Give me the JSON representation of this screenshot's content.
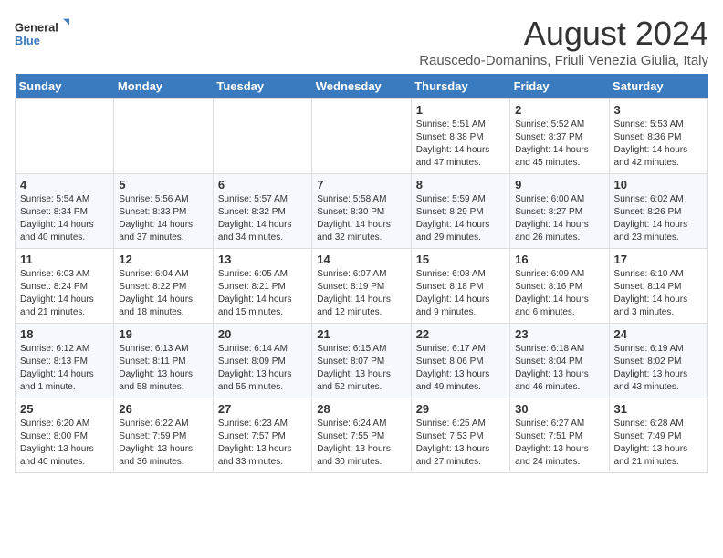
{
  "logo": {
    "line1": "General",
    "line2": "Blue"
  },
  "title": "August 2024",
  "subtitle": "Rauscedo-Domanins, Friuli Venezia Giulia, Italy",
  "days_of_week": [
    "Sunday",
    "Monday",
    "Tuesday",
    "Wednesday",
    "Thursday",
    "Friday",
    "Saturday"
  ],
  "weeks": [
    [
      {
        "num": "",
        "info": ""
      },
      {
        "num": "",
        "info": ""
      },
      {
        "num": "",
        "info": ""
      },
      {
        "num": "",
        "info": ""
      },
      {
        "num": "1",
        "info": "Sunrise: 5:51 AM\nSunset: 8:38 PM\nDaylight: 14 hours and 47 minutes."
      },
      {
        "num": "2",
        "info": "Sunrise: 5:52 AM\nSunset: 8:37 PM\nDaylight: 14 hours and 45 minutes."
      },
      {
        "num": "3",
        "info": "Sunrise: 5:53 AM\nSunset: 8:36 PM\nDaylight: 14 hours and 42 minutes."
      }
    ],
    [
      {
        "num": "4",
        "info": "Sunrise: 5:54 AM\nSunset: 8:34 PM\nDaylight: 14 hours and 40 minutes."
      },
      {
        "num": "5",
        "info": "Sunrise: 5:56 AM\nSunset: 8:33 PM\nDaylight: 14 hours and 37 minutes."
      },
      {
        "num": "6",
        "info": "Sunrise: 5:57 AM\nSunset: 8:32 PM\nDaylight: 14 hours and 34 minutes."
      },
      {
        "num": "7",
        "info": "Sunrise: 5:58 AM\nSunset: 8:30 PM\nDaylight: 14 hours and 32 minutes."
      },
      {
        "num": "8",
        "info": "Sunrise: 5:59 AM\nSunset: 8:29 PM\nDaylight: 14 hours and 29 minutes."
      },
      {
        "num": "9",
        "info": "Sunrise: 6:00 AM\nSunset: 8:27 PM\nDaylight: 14 hours and 26 minutes."
      },
      {
        "num": "10",
        "info": "Sunrise: 6:02 AM\nSunset: 8:26 PM\nDaylight: 14 hours and 23 minutes."
      }
    ],
    [
      {
        "num": "11",
        "info": "Sunrise: 6:03 AM\nSunset: 8:24 PM\nDaylight: 14 hours and 21 minutes."
      },
      {
        "num": "12",
        "info": "Sunrise: 6:04 AM\nSunset: 8:22 PM\nDaylight: 14 hours and 18 minutes."
      },
      {
        "num": "13",
        "info": "Sunrise: 6:05 AM\nSunset: 8:21 PM\nDaylight: 14 hours and 15 minutes."
      },
      {
        "num": "14",
        "info": "Sunrise: 6:07 AM\nSunset: 8:19 PM\nDaylight: 14 hours and 12 minutes."
      },
      {
        "num": "15",
        "info": "Sunrise: 6:08 AM\nSunset: 8:18 PM\nDaylight: 14 hours and 9 minutes."
      },
      {
        "num": "16",
        "info": "Sunrise: 6:09 AM\nSunset: 8:16 PM\nDaylight: 14 hours and 6 minutes."
      },
      {
        "num": "17",
        "info": "Sunrise: 6:10 AM\nSunset: 8:14 PM\nDaylight: 14 hours and 3 minutes."
      }
    ],
    [
      {
        "num": "18",
        "info": "Sunrise: 6:12 AM\nSunset: 8:13 PM\nDaylight: 14 hours and 1 minute."
      },
      {
        "num": "19",
        "info": "Sunrise: 6:13 AM\nSunset: 8:11 PM\nDaylight: 13 hours and 58 minutes."
      },
      {
        "num": "20",
        "info": "Sunrise: 6:14 AM\nSunset: 8:09 PM\nDaylight: 13 hours and 55 minutes."
      },
      {
        "num": "21",
        "info": "Sunrise: 6:15 AM\nSunset: 8:07 PM\nDaylight: 13 hours and 52 minutes."
      },
      {
        "num": "22",
        "info": "Sunrise: 6:17 AM\nSunset: 8:06 PM\nDaylight: 13 hours and 49 minutes."
      },
      {
        "num": "23",
        "info": "Sunrise: 6:18 AM\nSunset: 8:04 PM\nDaylight: 13 hours and 46 minutes."
      },
      {
        "num": "24",
        "info": "Sunrise: 6:19 AM\nSunset: 8:02 PM\nDaylight: 13 hours and 43 minutes."
      }
    ],
    [
      {
        "num": "25",
        "info": "Sunrise: 6:20 AM\nSunset: 8:00 PM\nDaylight: 13 hours and 40 minutes."
      },
      {
        "num": "26",
        "info": "Sunrise: 6:22 AM\nSunset: 7:59 PM\nDaylight: 13 hours and 36 minutes."
      },
      {
        "num": "27",
        "info": "Sunrise: 6:23 AM\nSunset: 7:57 PM\nDaylight: 13 hours and 33 minutes."
      },
      {
        "num": "28",
        "info": "Sunrise: 6:24 AM\nSunset: 7:55 PM\nDaylight: 13 hours and 30 minutes."
      },
      {
        "num": "29",
        "info": "Sunrise: 6:25 AM\nSunset: 7:53 PM\nDaylight: 13 hours and 27 minutes."
      },
      {
        "num": "30",
        "info": "Sunrise: 6:27 AM\nSunset: 7:51 PM\nDaylight: 13 hours and 24 minutes."
      },
      {
        "num": "31",
        "info": "Sunrise: 6:28 AM\nSunset: 7:49 PM\nDaylight: 13 hours and 21 minutes."
      }
    ]
  ]
}
